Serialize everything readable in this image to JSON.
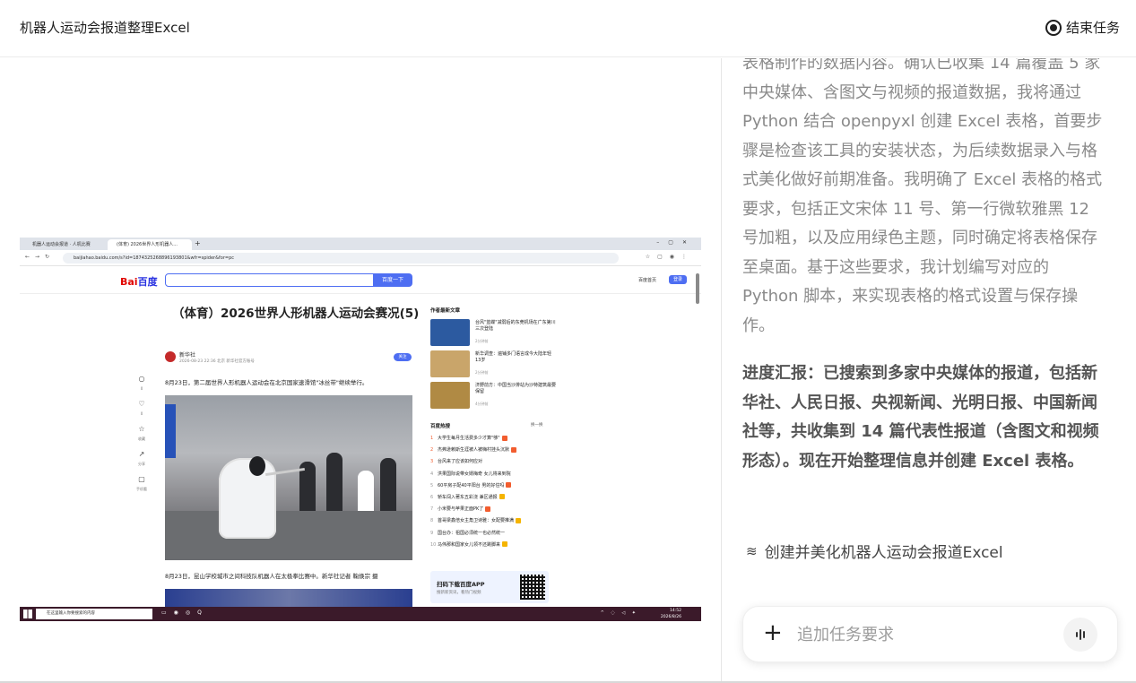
{
  "header": {
    "title": "机器人运动会报道整理Excel",
    "end_task_label": "结束任务"
  },
  "screenshot": {
    "tabs": [
      "机器人运动会报道 · 人机比赛",
      "(体育) 2026世界人形机器人..."
    ],
    "url": "baijiahao.baidu.com/s?id=1874325268896193801&wfr=spider&for=pc",
    "baidu_logo_a": "Bai",
    "baidu_logo_b": "百度",
    "search_button": "百度一下",
    "top_right_link": "百度首页",
    "login_button": "登录",
    "article_title": "（体育）2026世界人形机器人运动会赛况(5)",
    "author_name": "新华社",
    "author_meta": "2026-08-23 22:36 北京 新华社官方账号",
    "follow_label": "关注",
    "para1": "8月23日，第二届世界人形机器人运动会在北京国家速滑馆\"冰丝带\"继续举行。",
    "para2": "8月23日，昆山学校城市之间科技队机器人在太极拳比赛中。新华社记者 鞠焕宗 摄",
    "side_tools": [
      {
        "icon": "○",
        "label": "0"
      },
      {
        "icon": "♡",
        "label": "0"
      },
      {
        "icon": "☆",
        "label": "收藏"
      },
      {
        "icon": "↗",
        "label": "分享"
      },
      {
        "icon": "▢",
        "label": "手机看"
      }
    ],
    "related_title": "作者最新文章",
    "related": [
      {
        "text": "台风\"蓝蝶\"减弱后的东莞机场在广东第川三次登陆",
        "time": "2分钟前",
        "color": "#2c5aa0"
      },
      {
        "text": "新华调查：遍铺多门语言成今大陆年轻13岁",
        "time": "2分钟前",
        "color": "#c9a56a"
      },
      {
        "text": "济野前方：中国当沙排站为沙特建筑最要保留",
        "time": "4分钟前",
        "color": "#b08a44"
      }
    ],
    "hot_title": "百度热搜",
    "hot_refresh": "换一换",
    "hot_list": [
      {
        "n": "1",
        "text": "大学生每月生活费多少才算\"够\"",
        "tag": "#f25d2f"
      },
      {
        "n": "2",
        "text": "杰弗逊赖斯生涯被人被嗨村挂头沉默",
        "tag": "#f25d2f"
      },
      {
        "n": "3",
        "text": "台风来了应该如何应对",
        "tag": ""
      },
      {
        "n": "4",
        "text": "洪果国际说带女婿梅奇 女儿将来到院",
        "tag": ""
      },
      {
        "n": "5",
        "text": "60平房子配40平阳台 男的好住吗",
        "tag": "#f25d2f"
      },
      {
        "n": "6",
        "text": "轿车闯入著东五彩浇 兼区通报",
        "tag": "#f5b400"
      },
      {
        "n": "7",
        "text": "小米要与苹果正面PK了",
        "tag": "#f25d2f"
      },
      {
        "n": "8",
        "text": "首哥梁鑫倍女主角卫诗雅：女配要推满",
        "tag": "#f5b400"
      },
      {
        "n": "9",
        "text": "国台办：祖国必须统一也必然统一",
        "tag": ""
      },
      {
        "n": "10",
        "text": "马伟那和国家女儿领不还跳脚来",
        "tag": "#f5b400"
      }
    ],
    "app_card_title": "扫码下载百度APP",
    "app_card_sub": "搜新新资讯，看热门视频",
    "taskbar_search": "在这里输入你要搜索的内容",
    "taskbar_time": "14:52",
    "taskbar_date": "2026/8/26"
  },
  "chat": {
    "message": "表格制作的数据内容。确认已收集 14 篇覆盖 5 家中央媒体、含图文与视频的报道数据，我将通过 Python 结合 openpyxl 创建 Excel 表格，首要步骤是检查该工具的安装状态，为后续数据录入与格式美化做好前期准备。我明确了 Excel 表格的格式要求，包括正文宋体 11 号、第一行微软雅黑 12 号加粗，以及应用绿色主题，同时确定将表格保存至桌面。基于这些要求，我计划编写对应的 Python 脚本，来实现表格的格式设置与保存操作。",
    "progress": "进度汇报：已搜索到多家中央媒体的报道，包括新华社、人民日报、央视新闻、光明日报、中国新闻社等，共收集到 14 篇代表性报道（含图文和视频形态）。现在开始整理信息并创建 Excel 表格。",
    "task_link": "创建并美化机器人运动会报道Excel",
    "input_placeholder": "追加任务要求"
  }
}
